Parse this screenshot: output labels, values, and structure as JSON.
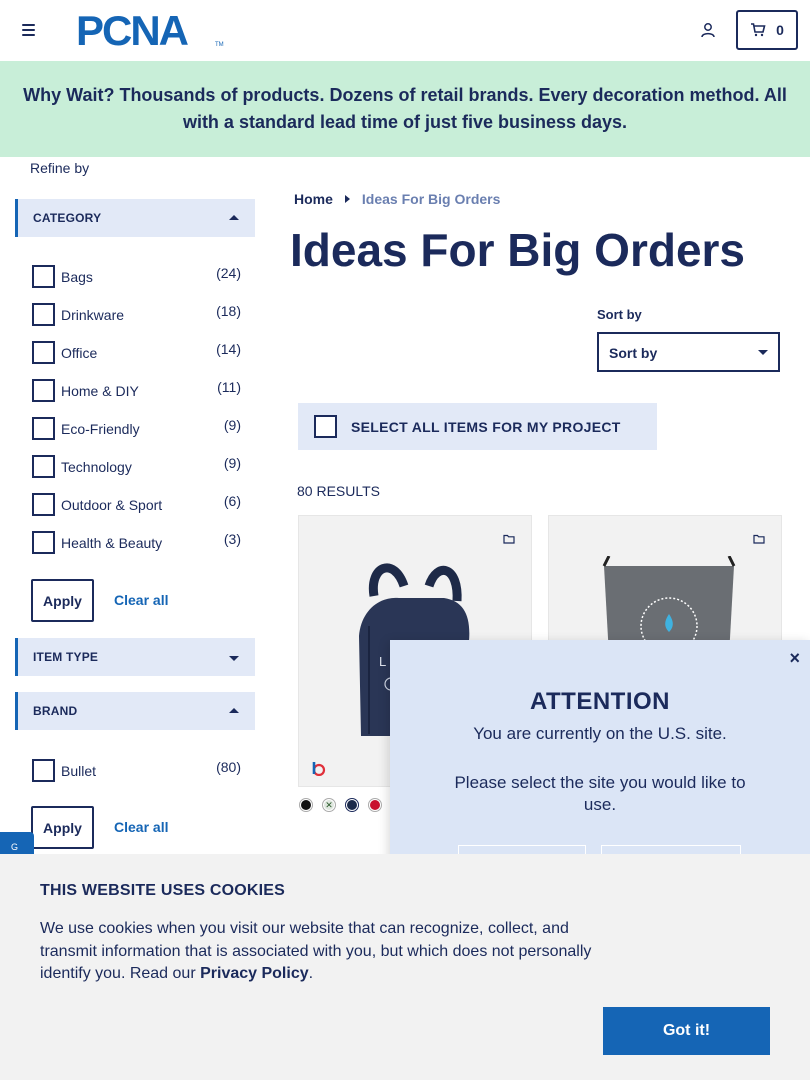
{
  "header": {
    "logo_text": "PCNA",
    "logo_tm": "TM",
    "cart_count": "0"
  },
  "banner": {
    "text": "Why Wait? Thousands of products. Dozens of retail brands. Every decoration method. All with a standard lead time of just five business days."
  },
  "sidebar": {
    "refine_label": "Refine by",
    "category": {
      "title": "CATEGORY",
      "items": [
        {
          "label": "Bags",
          "count": "(24)"
        },
        {
          "label": "Drinkware",
          "count": "(18)"
        },
        {
          "label": "Office",
          "count": "(14)"
        },
        {
          "label": "Home & DIY",
          "count": "(11)"
        },
        {
          "label": "Eco-Friendly",
          "count": "(9)"
        },
        {
          "label": "Technology",
          "count": "(9)"
        },
        {
          "label": "Outdoor & Sport",
          "count": "(6)"
        },
        {
          "label": "Health & Beauty",
          "count": "(3)"
        }
      ],
      "apply_label": "Apply",
      "clear_label": "Clear all"
    },
    "item_type": {
      "title": "ITEM TYPE"
    },
    "brand": {
      "title": "BRAND",
      "items": [
        {
          "label": "Bullet",
          "count": "(80)"
        }
      ],
      "apply_label": "Apply",
      "clear_label": "Clear all"
    },
    "side_tab_text": "G"
  },
  "main": {
    "breadcrumb": {
      "home": "Home",
      "current": "Ideas For Big Orders"
    },
    "title": "Ideas For Big Orders",
    "sort": {
      "label": "Sort by",
      "value": "Sort by"
    },
    "select_all": "SELECT ALL ITEMS FOR MY PROJECT",
    "results": "80 RESULTS",
    "products": [
      {
        "image": "navy-tote-bag",
        "swatches": [
          "#111111",
          "#dfe7df",
          "#1b2a4a",
          "#c8102e"
        ]
      },
      {
        "image": "gray-drawstring-bag"
      }
    ]
  },
  "popup": {
    "title": "ATTENTION",
    "line1": "You are currently on the U.S. site.",
    "line2": "Please select the site you would like to use.",
    "close": "×"
  },
  "cookie": {
    "title": "THIS WEBSITE USES COOKIES",
    "text_before": "We use cookies when you visit our website that can recognize, collect, and transmit information that is associated with you, but which does not personally identify you. Read our ",
    "link": "Privacy Policy",
    "text_after": ".",
    "button": "Got it!"
  },
  "colors": {
    "navy": "#1b2a5b",
    "brand_blue": "#1565b5",
    "banner_green": "#c8eed8",
    "panel_blue": "#e2e9f7"
  }
}
